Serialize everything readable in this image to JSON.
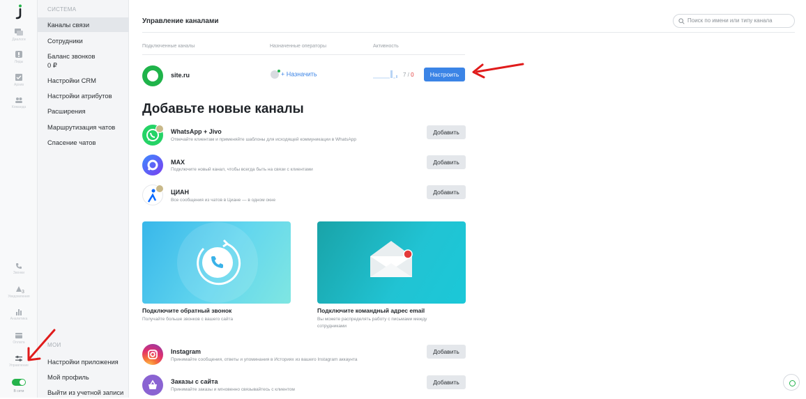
{
  "rail": {
    "items": [
      {
        "icon": "chat-icon",
        "label": "Диалоги"
      },
      {
        "icon": "inbox-icon",
        "label": "Лиды"
      },
      {
        "icon": "archive-icon",
        "label": "Архив"
      },
      {
        "icon": "team-icon",
        "label": "Команда"
      }
    ],
    "bottom_items": [
      {
        "icon": "phone-icon",
        "label": "Звонки"
      },
      {
        "icon": "bell-icon",
        "label": "Уведомления",
        "badge": "3"
      },
      {
        "icon": "stats-icon",
        "label": "Аналитика"
      },
      {
        "icon": "wallet-icon",
        "label": "Оплата"
      },
      {
        "icon": "sliders-icon",
        "label": "Управление"
      }
    ],
    "status_label": "В сети"
  },
  "menu": {
    "section_system": "СИСТЕМА",
    "system_items": [
      "Каналы связи",
      "Сотрудники",
      "Баланс звонков",
      "Настройки CRM",
      "Настройки атрибутов",
      "Расширения",
      "Маршрутизация чатов",
      "Спасение чатов"
    ],
    "balance_value": "0 ₽",
    "section_my": "МОИ",
    "my_items": [
      "Настройки приложения",
      "Мой профиль",
      "Выйти из учетной записи"
    ]
  },
  "header": {
    "title": "Управление каналами",
    "search_placeholder": "Поиск по имени или типу канала"
  },
  "table": {
    "columns": [
      "Подключенные каналы",
      "Назначенные операторы",
      "Активность"
    ],
    "row": {
      "name": "site.ru",
      "assign_label": "+ Назначить",
      "activity_main": "7",
      "activity_sep": " / ",
      "activity_alt": "0",
      "configure_label": "Настроить"
    }
  },
  "add_section": {
    "title": "Добавьте новые каналы",
    "add_label": "Добавить",
    "channels": [
      {
        "name": "WhatsApp + Jivo",
        "desc": "Отвечайте клиентам и применяйте шаблоны для исходящей коммуникации в WhatsApp",
        "color": "#25d366"
      },
      {
        "name": "MAX",
        "desc": "Подключите новый канал, чтобы всегда быть на связи с клиентами",
        "color": "#4a3df0"
      },
      {
        "name": "ЦИАН",
        "desc": "Все сообщения из чатов в Циане — в одном окне",
        "color": "#0468ff"
      }
    ],
    "cards": [
      {
        "title": "Подключите обратный звонок",
        "desc": "Получайте больше звонков с вашего сайта"
      },
      {
        "title": "Подключите командный адрес email",
        "desc": "Вы можете распределять работу с письмами между сотрудниками"
      }
    ],
    "more_channels": [
      {
        "name": "Instagram",
        "desc": "Принимайте сообщения, ответы и упоминания в Историях из вашего Instagram аккаунта"
      },
      {
        "name": "Заказы с сайта",
        "desc": "Принимайте заказы и мгновенно связывайтесь с клиентом"
      }
    ]
  }
}
